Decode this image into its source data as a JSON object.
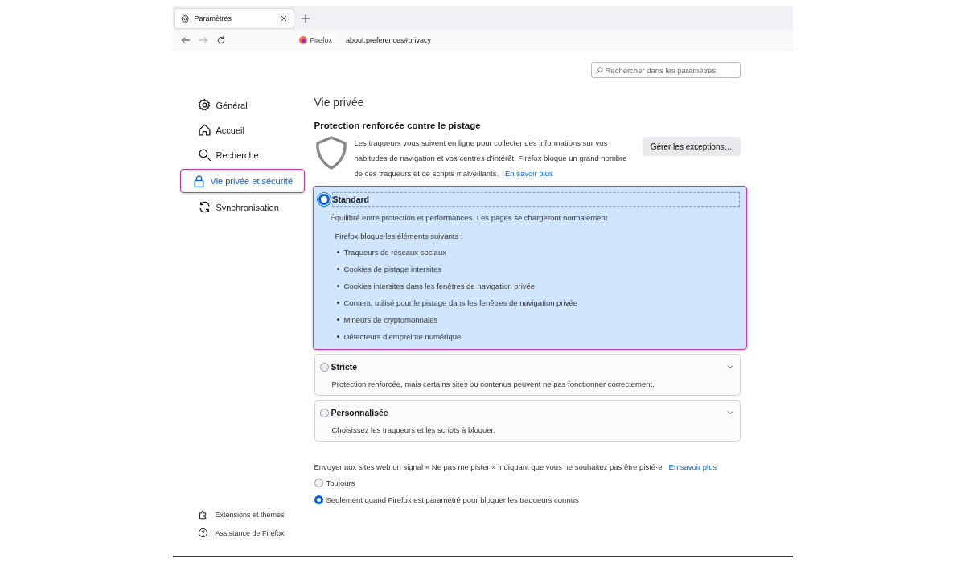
{
  "tab": {
    "title": "Paramètres",
    "selected": true
  },
  "address": {
    "identity": "Firefox",
    "url": "about:preferences#privacy"
  },
  "search": {
    "placeholder": "Rechercher dans les paramètres"
  },
  "sidebar": {
    "items": [
      {
        "label": "Général",
        "selected": false
      },
      {
        "label": "Accueil",
        "selected": false
      },
      {
        "label": "Recherche",
        "selected": false
      },
      {
        "label": "Vie privée et sécurité",
        "selected": true
      },
      {
        "label": "Synchronisation",
        "selected": false
      }
    ],
    "footer_items": [
      {
        "label": "Extensions et thèmes"
      },
      {
        "label": "Assistance de Firefox"
      }
    ]
  },
  "page_title": "Vie privée",
  "protection": {
    "title": "Protection renforcée contre le pistage",
    "description": "Les traqueurs vous suivent en ligne pour collecter des informations sur vos habitudes de navigation et vos centres d’intérêt. Firefox bloque un grand nombre de ces traqueurs et de scripts malveillants.",
    "link": "En savoir plus",
    "button": "Gérer les exceptions…"
  },
  "options": [
    {
      "label": "Standard",
      "description": "Équilibré entre protection et performances. Les pages se chargeront normalement.",
      "selected": true,
      "expanded": true,
      "blocks_title": "Firefox bloque les éléments suivants :",
      "blocks": [
        "Traqueurs de réseaux sociaux",
        "Cookies de pistage intersites",
        "Cookies intersites dans les fenêtres de navigation privée",
        "Contenu utilisé pour le pistage dans les fenêtres de navigation privée",
        "Mineurs de cryptomonnaies",
        "Détecteurs d’empreinte numérique"
      ]
    },
    {
      "label": "Stricte",
      "description": "Protection renforcée, mais certains sites ou contenus peuvent ne pas fonctionner correctement.",
      "selected": false,
      "expanded": false
    },
    {
      "label": "Personnalisée",
      "description": "Choisissez les traqueurs et les scripts à bloquer.",
      "selected": false,
      "expanded": false
    }
  ],
  "dnt": {
    "text": "Envoyer aux sites web un signal « Ne pas me pister » indiquant que vous ne souhaitez pas être pisté·e",
    "link": "En savoir plus",
    "choices": [
      {
        "label": "Toujours",
        "selected": false
      },
      {
        "label": "Seulement quand Firefox est paramétré pour bloquer les traqueurs connus",
        "selected": true
      }
    ]
  }
}
